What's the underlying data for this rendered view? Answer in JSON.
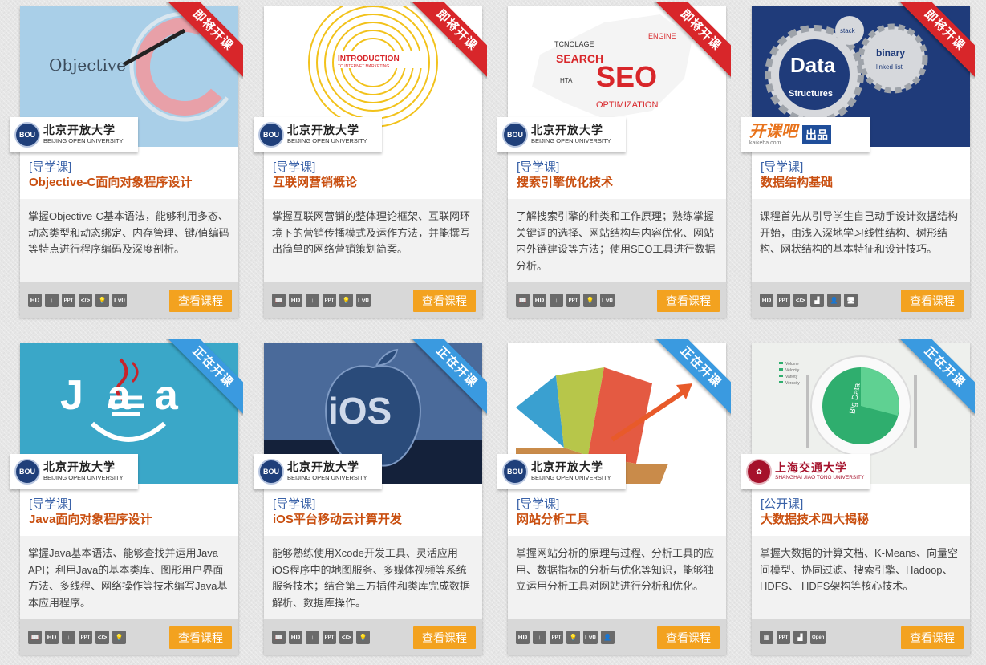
{
  "ribbons": {
    "upcoming": "即将开课",
    "ongoing": "正在开课"
  },
  "logos": {
    "bou_cn": "北京开放大学",
    "bou_en": "BEIJING OPEN UNIVERSITY",
    "bou_seal": "BOU",
    "kkb_name": "开课吧",
    "kkb_url": "kaikeba.com",
    "kkb_tag": "出品",
    "sjtu_cn": "上海交通大学",
    "sjtu_en": "SHANGHAI JIAO TONG UNIVERSITY"
  },
  "button_label": "查看课程",
  "thumb_text": {
    "objc": "Objective",
    "im_intro": "INTRODUCTION",
    "im_sub": "TO INTERNET MARKETING",
    "seo_main": "SEO",
    "seo_words": [
      "SEARCH",
      "TCNOLAGE",
      "OPTIMIZATION",
      "ENGINE",
      "HTA"
    ],
    "ds_main": "Data",
    "ds_sub": "Structures",
    "ds_gear1": "binary",
    "ds_gear2": "linked list",
    "ds_gear3": "stack",
    "java_main": "Jaa",
    "ios_main": "iOS",
    "bigdata_main": "Big Data",
    "bigdata_legend": [
      "Volume",
      "Velocity",
      "Variety",
      "Veracity"
    ]
  },
  "courses": [
    {
      "status": "upcoming",
      "type": "[导学课]",
      "title": "Objective-C面向对象程序设计",
      "desc": "掌握Objective-C基本语法，能够利用多态、动态类型和动态绑定、内存管理、键/值编码等特点进行程序编码及深度剖析。",
      "icons": [
        "HD",
        "↓",
        "PPT",
        "</>",
        "💡",
        "Lv0"
      ]
    },
    {
      "status": "upcoming",
      "type": "[导学课]",
      "title": "互联网营销概论",
      "desc": "掌握互联网营销的整体理论框架、互联网环境下的营销传播模式及运作方法，并能撰写出简单的网络营销策划简案。",
      "icons": [
        "📖",
        "HD",
        "↓",
        "PPT",
        "💡",
        "Lv0"
      ]
    },
    {
      "status": "upcoming",
      "type": "[导学课]",
      "title": "搜索引擎优化技术",
      "desc": "了解搜索引擎的种类和工作原理；熟练掌握关键词的选择、网站结构与内容优化、网站内外链建设等方法；使用SEO工具进行数据分析。",
      "icons": [
        "📖",
        "HD",
        "↓",
        "PPT",
        "💡",
        "Lv0"
      ]
    },
    {
      "status": "upcoming",
      "type": "[导学课]",
      "title": "数据结构基础",
      "desc": "课程首先从引导学生自己动手设计数据结构开始，由浅入深地学习线性结构、树形结构、网状结构的基本特征和设计技巧。",
      "icons": [
        "HD",
        "PPT",
        "</>",
        "▟",
        "👤",
        "🖥"
      ]
    },
    {
      "status": "ongoing",
      "type": "[导学课]",
      "title": "Java面向对象程序设计",
      "desc": "掌握Java基本语法、能够查找并运用Java API；利用Java的基本类库、图形用户界面方法、多线程、网络操作等技术编写Java基本应用程序。",
      "icons": [
        "📖",
        "HD",
        "↓",
        "PPT",
        "</>",
        "💡"
      ]
    },
    {
      "status": "ongoing",
      "type": "[导学课]",
      "title": "iOS平台移动云计算开发",
      "desc": "能够熟练使用Xcode开发工具、灵活应用iOS程序中的地图服务、多媒体视频等系统服务技术；结合第三方插件和类库完成数据解析、数据库操作。",
      "icons": [
        "📖",
        "HD",
        "↓",
        "PPT",
        "</>",
        "💡"
      ]
    },
    {
      "status": "ongoing",
      "type": "[导学课]",
      "title": "网站分析工具",
      "desc": "掌握网站分析的原理与过程、分析工具的应用、数据指标的分析与优化等知识，能够独立运用分析工具对网站进行分析和优化。",
      "icons": [
        "HD",
        "↓",
        "PPT",
        "💡",
        "Lv0",
        "👤"
      ]
    },
    {
      "status": "ongoing",
      "type": "[公开课]",
      "title": "大数据技术四大揭秘",
      "desc": "掌握大数据的计算文档、K-Means、向量空间模型、协同过滤、搜索引擎、Hadoop、HDFS、 HDFS架构等核心技术。",
      "icons": [
        "▦",
        "PPT",
        "▟",
        "Open"
      ]
    }
  ]
}
